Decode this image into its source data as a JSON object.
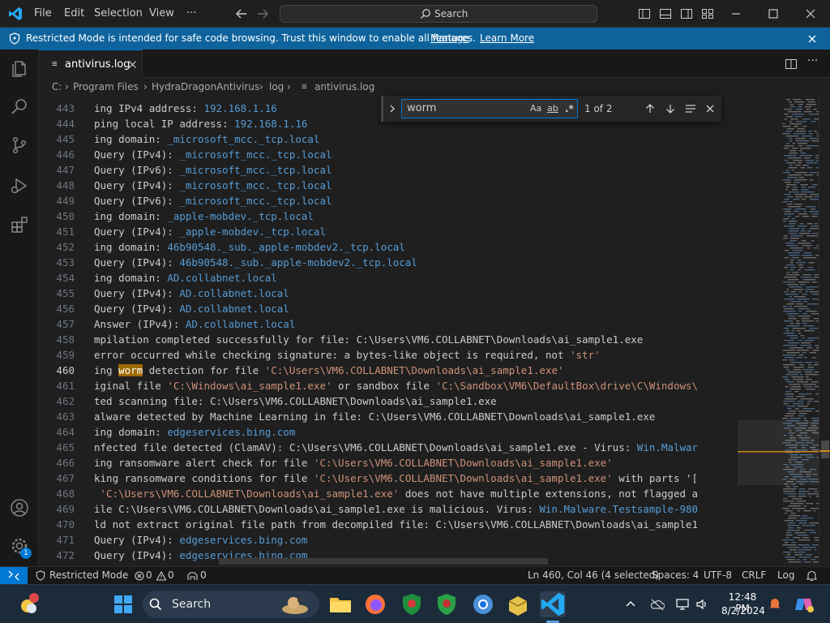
{
  "titlebar": {
    "menu": [
      "File",
      "Edit",
      "Selection",
      "View",
      "···"
    ],
    "search_label": "Search"
  },
  "banner": {
    "message": "Restricted Mode is intended for safe code browsing. Trust this window to enable all features.",
    "manage": "Manage",
    "learn_more": "Learn More"
  },
  "tab": {
    "label": "antivirus.log"
  },
  "breadcrumb": [
    "C:",
    "Program Files",
    "HydraDragonAntivirus",
    "log",
    "antivirus.log"
  ],
  "find": {
    "query": "worm",
    "aa": "Aa",
    "ab": "ab",
    "regex": ".*",
    "result": "1 of 2"
  },
  "editor": {
    "current_line": 460,
    "lines": [
      {
        "n": "443",
        "parts": [
          [
            "ing IPv4 address: ",
            ""
          ],
          [
            "192.168.1.16",
            "v"
          ]
        ]
      },
      {
        "n": "444",
        "parts": [
          [
            "ping local IP address: ",
            ""
          ],
          [
            "192.168.1.16",
            "v"
          ]
        ]
      },
      {
        "n": "445",
        "parts": [
          [
            "ing domain: ",
            ""
          ],
          [
            "_microsoft_mcc._tcp.local",
            "v"
          ]
        ]
      },
      {
        "n": "446",
        "parts": [
          [
            "Query (IPv4): ",
            ""
          ],
          [
            "_microsoft_mcc._tcp.local",
            "v"
          ]
        ]
      },
      {
        "n": "447",
        "parts": [
          [
            "Query (IPv6): ",
            ""
          ],
          [
            "_microsoft_mcc._tcp.local",
            "v"
          ]
        ]
      },
      {
        "n": "448",
        "parts": [
          [
            "Query (IPv4): ",
            ""
          ],
          [
            "_microsoft_mcc._tcp.local",
            "v"
          ]
        ]
      },
      {
        "n": "449",
        "parts": [
          [
            "Query (IPv6): ",
            ""
          ],
          [
            "_microsoft_mcc._tcp.local",
            "v"
          ]
        ]
      },
      {
        "n": "450",
        "parts": [
          [
            "ing domain: ",
            ""
          ],
          [
            "_apple-mobdev._tcp.local",
            "v"
          ]
        ]
      },
      {
        "n": "451",
        "parts": [
          [
            "Query (IPv4): ",
            ""
          ],
          [
            "_apple-mobdev._tcp.local",
            "v"
          ]
        ]
      },
      {
        "n": "452",
        "parts": [
          [
            "ing domain: ",
            ""
          ],
          [
            "46b90548._sub._apple-mobdev2._tcp.local",
            "v"
          ]
        ]
      },
      {
        "n": "453",
        "parts": [
          [
            "Query (IPv4): ",
            ""
          ],
          [
            "46b90548._sub._apple-mobdev2._tcp.local",
            "v"
          ]
        ]
      },
      {
        "n": "454",
        "parts": [
          [
            "ing domain: ",
            ""
          ],
          [
            "AD.collabnet.local",
            "v"
          ]
        ]
      },
      {
        "n": "455",
        "parts": [
          [
            "Query (IPv4): ",
            ""
          ],
          [
            "AD.collabnet.local",
            "v"
          ]
        ]
      },
      {
        "n": "456",
        "parts": [
          [
            "Query (IPv4): ",
            ""
          ],
          [
            "AD.collabnet.local",
            "v"
          ]
        ]
      },
      {
        "n": "457",
        "parts": [
          [
            "Answer (IPv4): ",
            ""
          ],
          [
            "AD.collabnet.local",
            "v"
          ]
        ]
      },
      {
        "n": "458",
        "parts": [
          [
            "mpilation completed successfully for file: C:\\Users\\VM6.COLLABNET\\Downloads\\ai_sample1.exe",
            ""
          ]
        ]
      },
      {
        "n": "459",
        "parts": [
          [
            "error occurred while checking signature: a bytes-like object is required, not ",
            ""
          ],
          [
            "'str'",
            "s"
          ]
        ]
      },
      {
        "n": "460",
        "parts": [
          [
            "ing ",
            ""
          ],
          [
            "worm",
            "hl"
          ],
          [
            " detection for file ",
            ""
          ],
          [
            "'C:\\Users\\VM6.COLLABNET\\Downloads\\ai_sample1.exe'",
            "s"
          ]
        ]
      },
      {
        "n": "461",
        "parts": [
          [
            "iginal file ",
            ""
          ],
          [
            "'C:\\Windows\\ai_sample1.exe'",
            "s"
          ],
          [
            " or sandbox file ",
            ""
          ],
          [
            "'C:\\Sandbox\\VM6\\DefaultBox\\drive\\C\\Windows\\",
            "s"
          ]
        ]
      },
      {
        "n": "462",
        "parts": [
          [
            "ted scanning file: C:\\Users\\VM6.COLLABNET\\Downloads\\ai_sample1.exe",
            ""
          ]
        ]
      },
      {
        "n": "463",
        "parts": [
          [
            "alware detected by Machine Learning in file: C:\\Users\\VM6.COLLABNET\\Downloads\\ai_sample1.exe",
            ""
          ]
        ]
      },
      {
        "n": "464",
        "parts": [
          [
            "ing domain: ",
            ""
          ],
          [
            "edgeservices.bing.com",
            "v"
          ]
        ]
      },
      {
        "n": "465",
        "parts": [
          [
            "nfected file detected (ClamAV): C:\\Users\\VM6.COLLABNET\\Downloads\\ai_sample1.exe - Virus: ",
            ""
          ],
          [
            "Win.Malwar",
            "v"
          ]
        ]
      },
      {
        "n": "466",
        "parts": [
          [
            "ing ransomware alert check for file ",
            ""
          ],
          [
            "'C:\\Users\\VM6.COLLABNET\\Downloads\\ai_sample1.exe'",
            "s"
          ]
        ]
      },
      {
        "n": "467",
        "parts": [
          [
            "king ransomware conditions for file ",
            ""
          ],
          [
            "'C:\\Users\\VM6.COLLABNET\\Downloads\\ai_sample1.exe'",
            "s"
          ],
          [
            " with parts '[",
            ""
          ]
        ]
      },
      {
        "n": "468",
        "parts": [
          [
            " ",
            ""
          ],
          [
            "'C:\\Users\\VM6.COLLABNET\\Downloads\\ai_sample1.exe'",
            "s"
          ],
          [
            " does not have multiple extensions, not flagged a",
            ""
          ]
        ]
      },
      {
        "n": "469",
        "parts": [
          [
            "ile C:\\Users\\VM6.COLLABNET\\Downloads\\ai_sample1.exe is malicious. Virus: ",
            ""
          ],
          [
            "Win.Malware.Testsample-980",
            "v"
          ]
        ]
      },
      {
        "n": "470",
        "parts": [
          [
            "ld not extract original file path from decompiled file: C:\\Users\\VM6.COLLABNET\\Downloads\\ai_sample1",
            ""
          ]
        ]
      },
      {
        "n": "471",
        "parts": [
          [
            "Query (IPv4): ",
            ""
          ],
          [
            "edgeservices.bing.com",
            "v"
          ]
        ]
      },
      {
        "n": "472",
        "parts": [
          [
            "Query (IPv4): ",
            ""
          ],
          [
            "edgeservices.bing.com",
            "v"
          ]
        ]
      }
    ]
  },
  "statusbar": {
    "mode": "Restricted Mode",
    "errors": "0",
    "warnings": "0",
    "ports": "0",
    "position": "Ln 460, Col 46 (4 selected)",
    "spaces": "Spaces: 4",
    "encoding": "UTF-8",
    "eol": "CRLF",
    "language": "Log"
  },
  "taskbar": {
    "search_label": "Search",
    "time": "12:48 PM",
    "date": "8/2/2024",
    "settings_badge": "1"
  },
  "colors": {
    "accent": "#0078d4",
    "banner": "#0e639c",
    "value": "#569cd6",
    "string": "#ce9178",
    "match": "#9e6a03"
  }
}
